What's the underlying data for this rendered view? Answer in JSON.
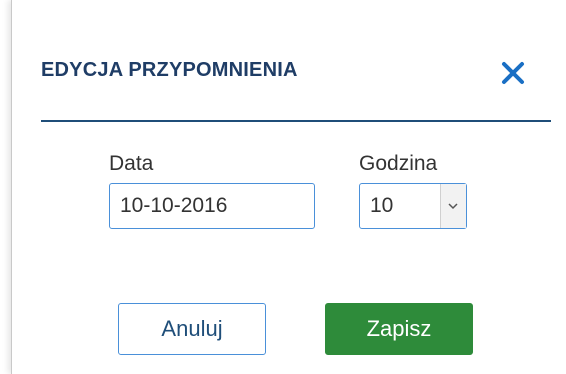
{
  "dialog": {
    "title": "EDYCJA PRZYPOMNIENIA",
    "close_icon": "close-icon"
  },
  "form": {
    "date": {
      "label": "Data",
      "value": "10-10-2016"
    },
    "hour": {
      "label": "Godzina",
      "selected": "10",
      "arrow_icon": "chevron-down-icon"
    }
  },
  "buttons": {
    "cancel_label": "Anuluj",
    "save_label": "Zapisz"
  },
  "colors": {
    "title": "#1f3d66",
    "accent_blue": "#4a90d9",
    "close_icon": "#1a6fc4",
    "save_button": "#2e8b3a"
  }
}
